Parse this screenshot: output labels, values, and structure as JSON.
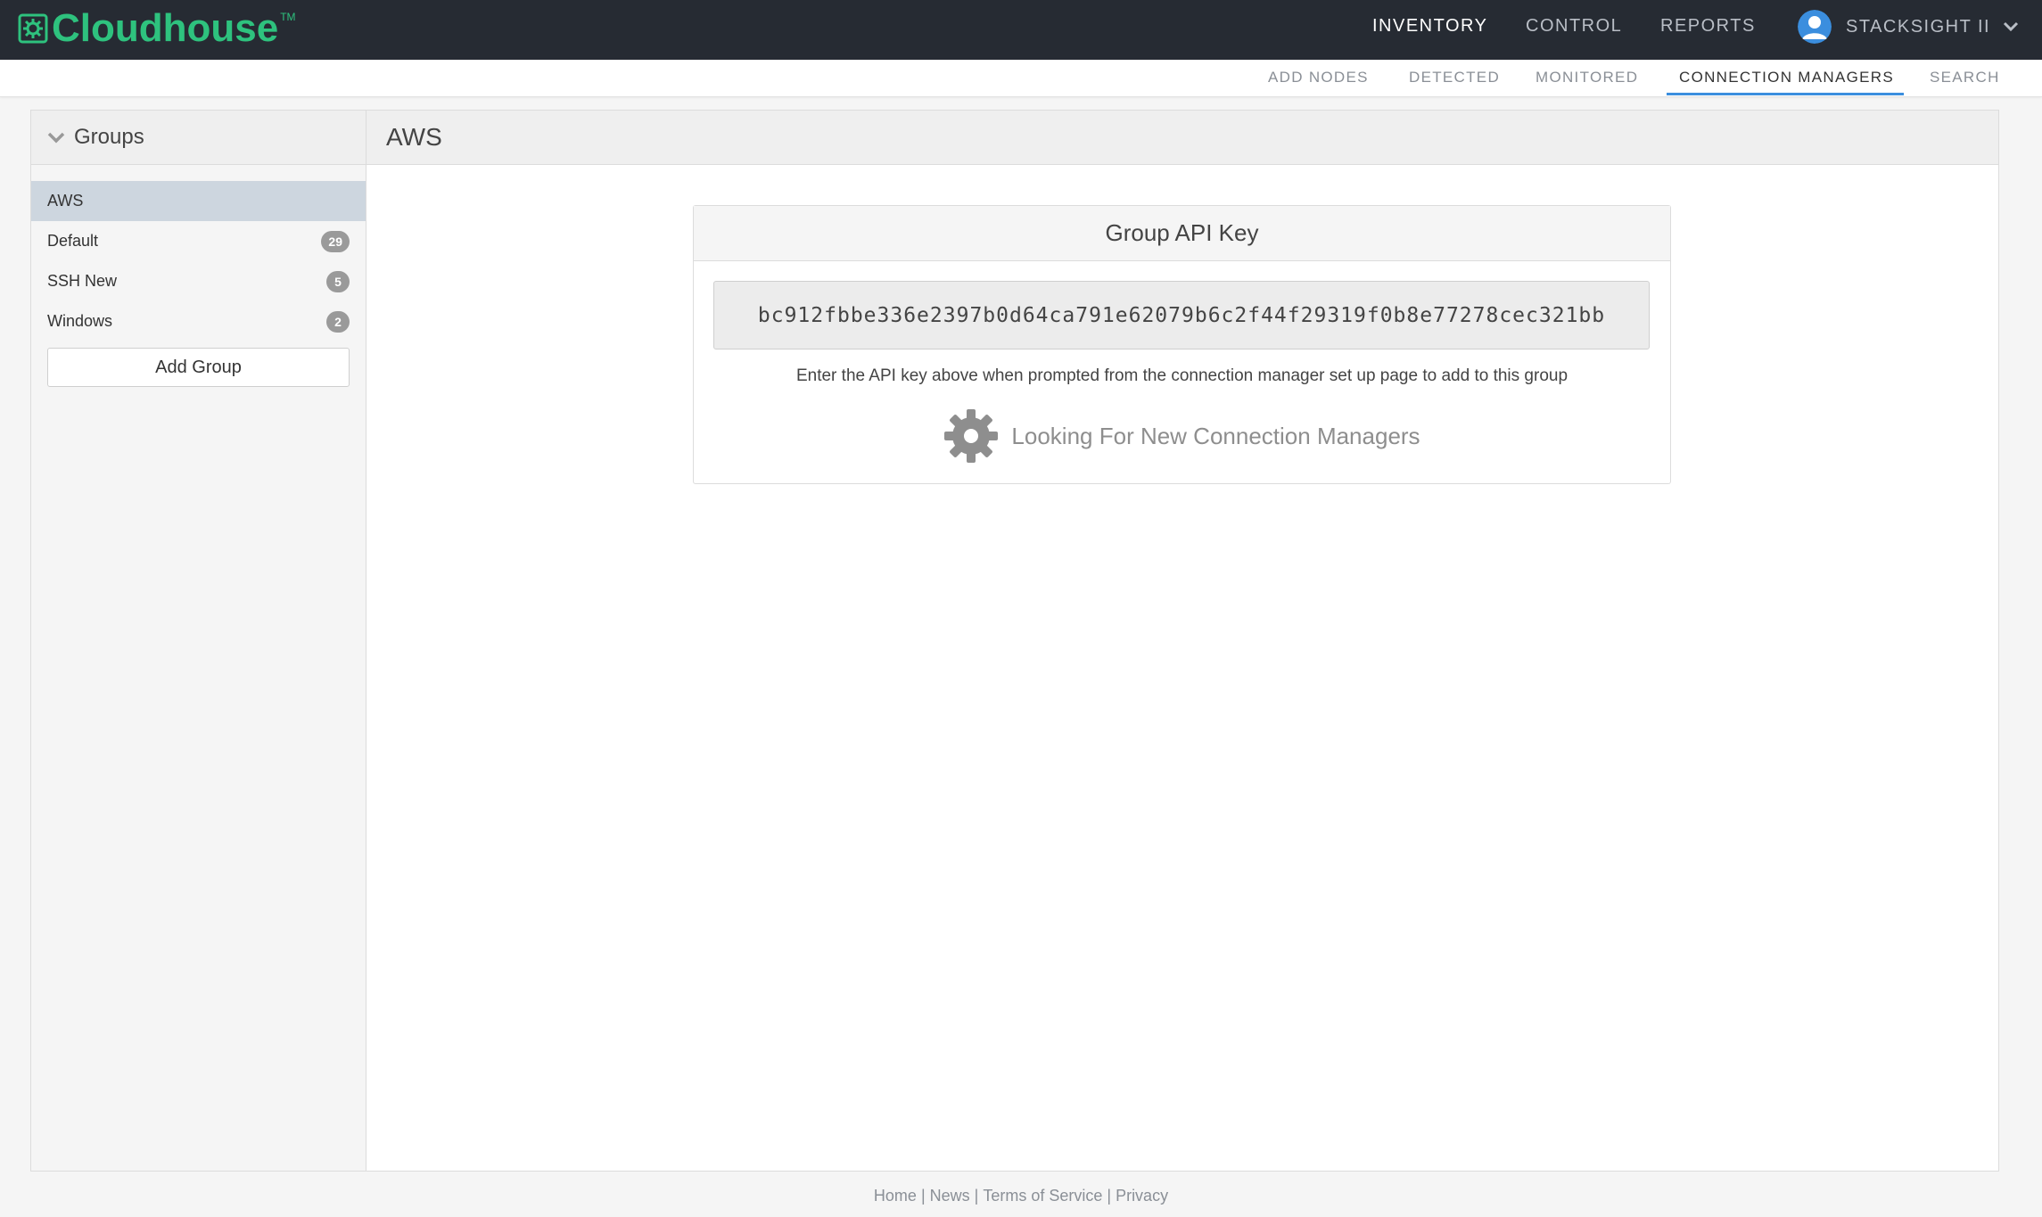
{
  "brand": {
    "name": "Cloudhouse",
    "trademark": "TM",
    "color": "#2ec27e",
    "icon": "gear-square-icon"
  },
  "top_nav": {
    "items": [
      {
        "label": "INVENTORY",
        "active": true
      },
      {
        "label": "CONTROL",
        "active": false
      },
      {
        "label": "REPORTS",
        "active": false
      }
    ],
    "user": {
      "name": "STACKSIGHT II",
      "avatar_icon": "user-avatar-icon",
      "menu_icon": "chevron-down-icon"
    }
  },
  "sub_nav": {
    "items": [
      {
        "label": "ADD NODES",
        "active": false
      },
      {
        "label": "DETECTED",
        "active": false
      },
      {
        "label": "MONITORED",
        "active": false
      },
      {
        "label": "CONNECTION MANAGERS",
        "active": true
      },
      {
        "label": "SEARCH",
        "active": false
      }
    ],
    "accent_color": "#3b8ede"
  },
  "sidebar": {
    "title": "Groups",
    "groups": [
      {
        "name": "AWS",
        "count": "",
        "selected": true
      },
      {
        "name": "Default",
        "count": "29",
        "selected": false
      },
      {
        "name": "SSH New",
        "count": "5",
        "selected": false
      },
      {
        "name": "Windows",
        "count": "2",
        "selected": false
      }
    ],
    "add_group_label": "Add Group"
  },
  "content": {
    "title": "AWS",
    "api_card": {
      "title": "Group API Key",
      "api_key": "bc912fbbe336e2397b0d64ca791e62079b6c2f44f29319f0b8e77278cec321bb",
      "hint": "Enter the API key above when prompted from the connection manager set up page to add to this group",
      "status_text": "Looking For New Connection Managers",
      "status_icon": "gear-icon"
    }
  },
  "footer": {
    "links": [
      "Home",
      "News",
      "Terms of Service",
      "Privacy"
    ],
    "separator": "|"
  }
}
